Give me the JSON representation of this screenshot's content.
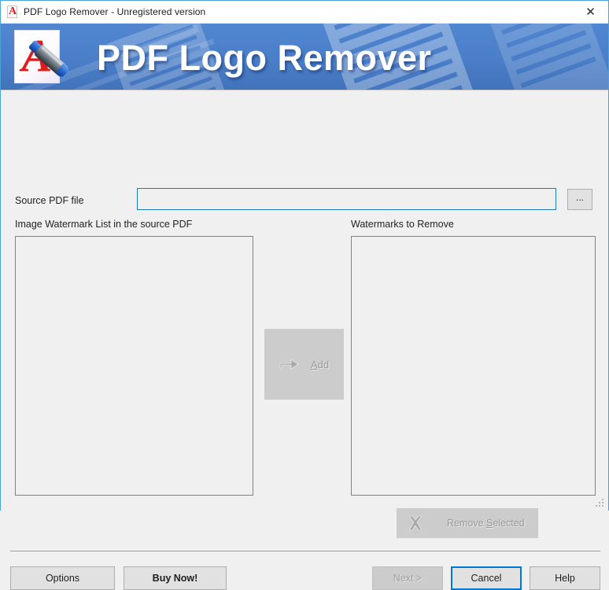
{
  "window": {
    "title": "PDF Logo Remover - Unregistered version",
    "title_icon": "pdf-document-icon",
    "close_label": "✕",
    "border_color": "#4aa3d8"
  },
  "banner": {
    "title": "PDF Logo Remover",
    "logo_icon": "pdf-marker-logo-icon",
    "background_color": "#4a7ec8",
    "title_color": "#ffffff"
  },
  "form": {
    "source_label": "Source PDF file",
    "source_value": "",
    "source_placeholder": "",
    "browse_label": "...",
    "left_list_label": "Image Watermark List in the source PDF",
    "right_list_label": "Watermarks to Remove",
    "left_list_items": [],
    "right_list_items": [],
    "input_border_color": "#1e7bb0"
  },
  "actions": {
    "add_label_prefix": "A",
    "add_label_suffix": "dd",
    "add_icon": "arrow-right-icon",
    "add_enabled": false,
    "remove_label_prefix": "Remove ",
    "remove_label_accel": "S",
    "remove_label_suffix": "elected",
    "remove_icon": "x-delete-icon",
    "remove_enabled": false
  },
  "footer": {
    "options_label": "Options",
    "buy_label": "Buy Now!",
    "next_label": "Next >",
    "cancel_label": "Cancel",
    "help_label": "Help",
    "focus_color": "#0078d7",
    "resize_grip": "resize-grip-icon"
  }
}
